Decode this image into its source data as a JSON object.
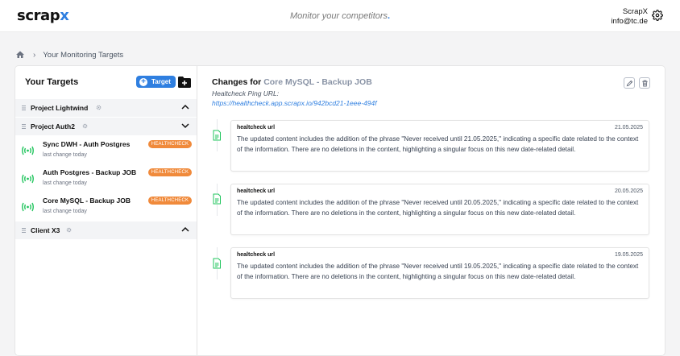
{
  "header": {
    "logo_main": "scrap",
    "logo_accent": "x",
    "tagline": "Monitor your competitors",
    "tagline_dot": ".",
    "user_name": "ScrapX",
    "user_email": "info@tc.de"
  },
  "breadcrumb": {
    "current": "Your Monitoring Targets"
  },
  "sidebar": {
    "title": "Your Targets",
    "add_target_label": "Target",
    "groups": [
      {
        "name": "Project Lightwind",
        "expanded": true
      },
      {
        "name": "Project Auth2",
        "expanded": false
      },
      {
        "name": "Client X3",
        "expanded": true
      }
    ],
    "items": [
      {
        "name": "Sync DWH - Auth Postgres",
        "sub": "last change today",
        "badge": "HEALTHCHECK"
      },
      {
        "name": "Auth Postgres - Backup JOB",
        "sub": "last change today",
        "badge": "HEALTHCHECK"
      },
      {
        "name": "Core MySQL - Backup JOB",
        "sub": "last change today",
        "badge": "HEALTHCHECK"
      }
    ]
  },
  "detail": {
    "title_prefix": "Changes for",
    "title_name": "Core MySQL - Backup JOB",
    "ping_label": "Healtcheck Ping URL:",
    "ping_url": "https://healthcheck.app.scrapx.io/942bcd21-1eee-494f",
    "entries": [
      {
        "title": "healtcheck url",
        "date": "21.05.2025",
        "text": "The updated content includes the addition of the phrase \"Never received until 21.05.2025,\" indicating a specific date related to the context of the information. There are no deletions in the content, highlighting a singular focus on this new date-related detail."
      },
      {
        "title": "healtcheck url",
        "date": "20.05.2025",
        "text": "The updated content includes the addition of the phrase \"Never received until 20.05.2025,\" indicating a specific date related to the context of the information. There are no deletions in the content, highlighting a singular focus on this new date-related detail."
      },
      {
        "title": "healtcheck url",
        "date": "19.05.2025",
        "text": "The updated content includes the addition of the phrase \"Never received until 19.05.2025,\" indicating a specific date related to the context of the information. There are no deletions in the content, highlighting a singular focus on this new date-related detail."
      }
    ]
  },
  "colors": {
    "accent": "#2f7fe0",
    "badge": "#f08a3b",
    "signal": "#22c55e"
  },
  "icons": [
    "home-icon",
    "gear-icon",
    "plus-circle-icon",
    "add-folder-icon",
    "drag-handle-icon",
    "settings-cog-icon",
    "caret-up-icon",
    "caret-down-icon",
    "signal-icon",
    "edit-icon",
    "trash-icon",
    "document-icon"
  ]
}
